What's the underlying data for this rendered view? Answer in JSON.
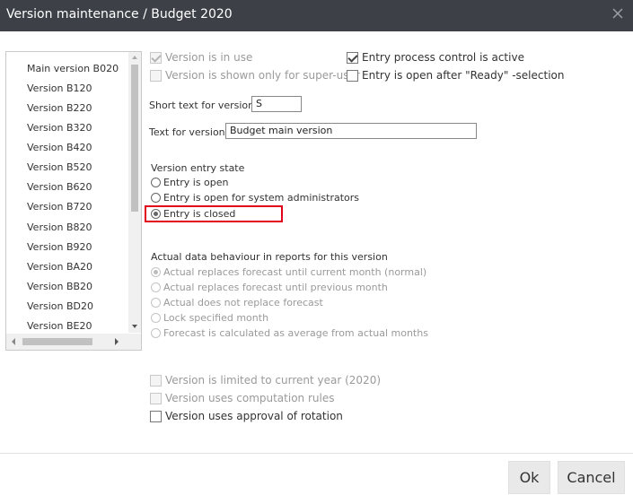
{
  "window": {
    "title": "Version maintenance / Budget 2020"
  },
  "versions": [
    "Main version B020",
    "Version B120",
    "Version B220",
    "Version B320",
    "Version B420",
    "Version B520",
    "Version B620",
    "Version B720",
    "Version B820",
    "Version B920",
    "Version BA20",
    "Version BB20",
    "Version BD20",
    "Version BE20"
  ],
  "options": {
    "in_use": "Version is in use",
    "super_user": "Version is shown only for super-user",
    "process_control": "Entry process control is active",
    "open_after_ready": "Entry is open after \"Ready\" -selection"
  },
  "fields": {
    "short_text_label": "Short text for version:",
    "short_text_value": "S",
    "text_label": "Text for version:",
    "text_value": "Budget main version"
  },
  "entry_state": {
    "heading": "Version entry state",
    "options": [
      "Entry is open",
      "Entry is open for system administrators",
      "Entry is closed"
    ],
    "selected": "Entry is closed"
  },
  "actual_behaviour": {
    "heading": "Actual data behaviour in reports for this version",
    "options": [
      "Actual replaces forecast until current month (normal)",
      "Actual replaces forecast until previous month",
      "Actual does not replace forecast",
      "Lock specified month",
      "Forecast is calculated as average from actual months"
    ],
    "selected": "Actual replaces forecast until current month (normal)"
  },
  "bottom_options": {
    "limited_year": "Version is limited to current year (2020)",
    "computation_rules": "Version uses computation rules",
    "approval_rotation": "Version uses approval of rotation"
  },
  "buttons": {
    "ok": "Ok",
    "cancel": "Cancel"
  },
  "colors": {
    "titlebar": "#3d4147",
    "highlight": "#e3001b"
  }
}
